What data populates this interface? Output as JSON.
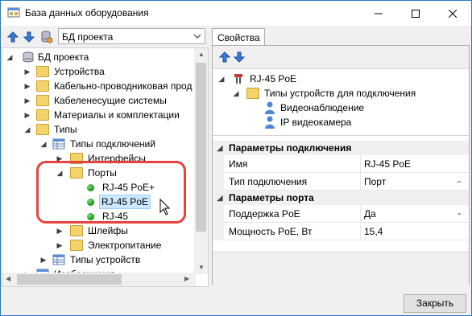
{
  "window": {
    "title": "База данных оборудования",
    "minimize_icon": "minimize-icon",
    "maximize_icon": "maximize-icon",
    "close_icon": "close-icon"
  },
  "left_toolbar": {
    "up_icon": "arrow-up-icon",
    "down_icon": "arrow-down-icon",
    "db_icon": "database-settings-icon",
    "source_select": {
      "value": "БД проекта"
    }
  },
  "tree": {
    "root": "БД проекта",
    "items": [
      "Устройства",
      "Кабельно-проводниковая прод",
      "Кабеленесущие системы",
      "Материалы и комплектации",
      "Типы",
      "Типы подключений",
      "Интерфейсы",
      "Порты",
      "RJ-45 PoE+",
      "RJ-45 PoE",
      "RJ-45",
      "Шлейфы",
      "Электропитание",
      "Типы устройств",
      "Изображения"
    ],
    "selected": "RJ-45 PoE",
    "highlight_color": "#e8423f"
  },
  "properties": {
    "tab_label": "Свойства",
    "up_icon": "arrow-up-icon",
    "down_icon": "arrow-down-icon",
    "info": {
      "item": "RJ-45 PoE",
      "group": "Типы устройств для подключения",
      "children": [
        "Видеонаблюдение",
        "IP видеокамера"
      ]
    },
    "categories": [
      {
        "title": "Параметры подключения",
        "rows": [
          {
            "name": "Имя",
            "value": "RJ-45 PoE",
            "dropdown": false
          },
          {
            "name": "Тип подключения",
            "value": "Порт",
            "dropdown": true
          }
        ]
      },
      {
        "title": "Параметры порта",
        "rows": [
          {
            "name": "Поддержка PoE",
            "value": "Да",
            "dropdown": true
          },
          {
            "name": "Мощность PoE, Вт",
            "value": "15,4",
            "dropdown": false
          }
        ]
      }
    ]
  },
  "footer": {
    "close_label": "Закрыть"
  }
}
